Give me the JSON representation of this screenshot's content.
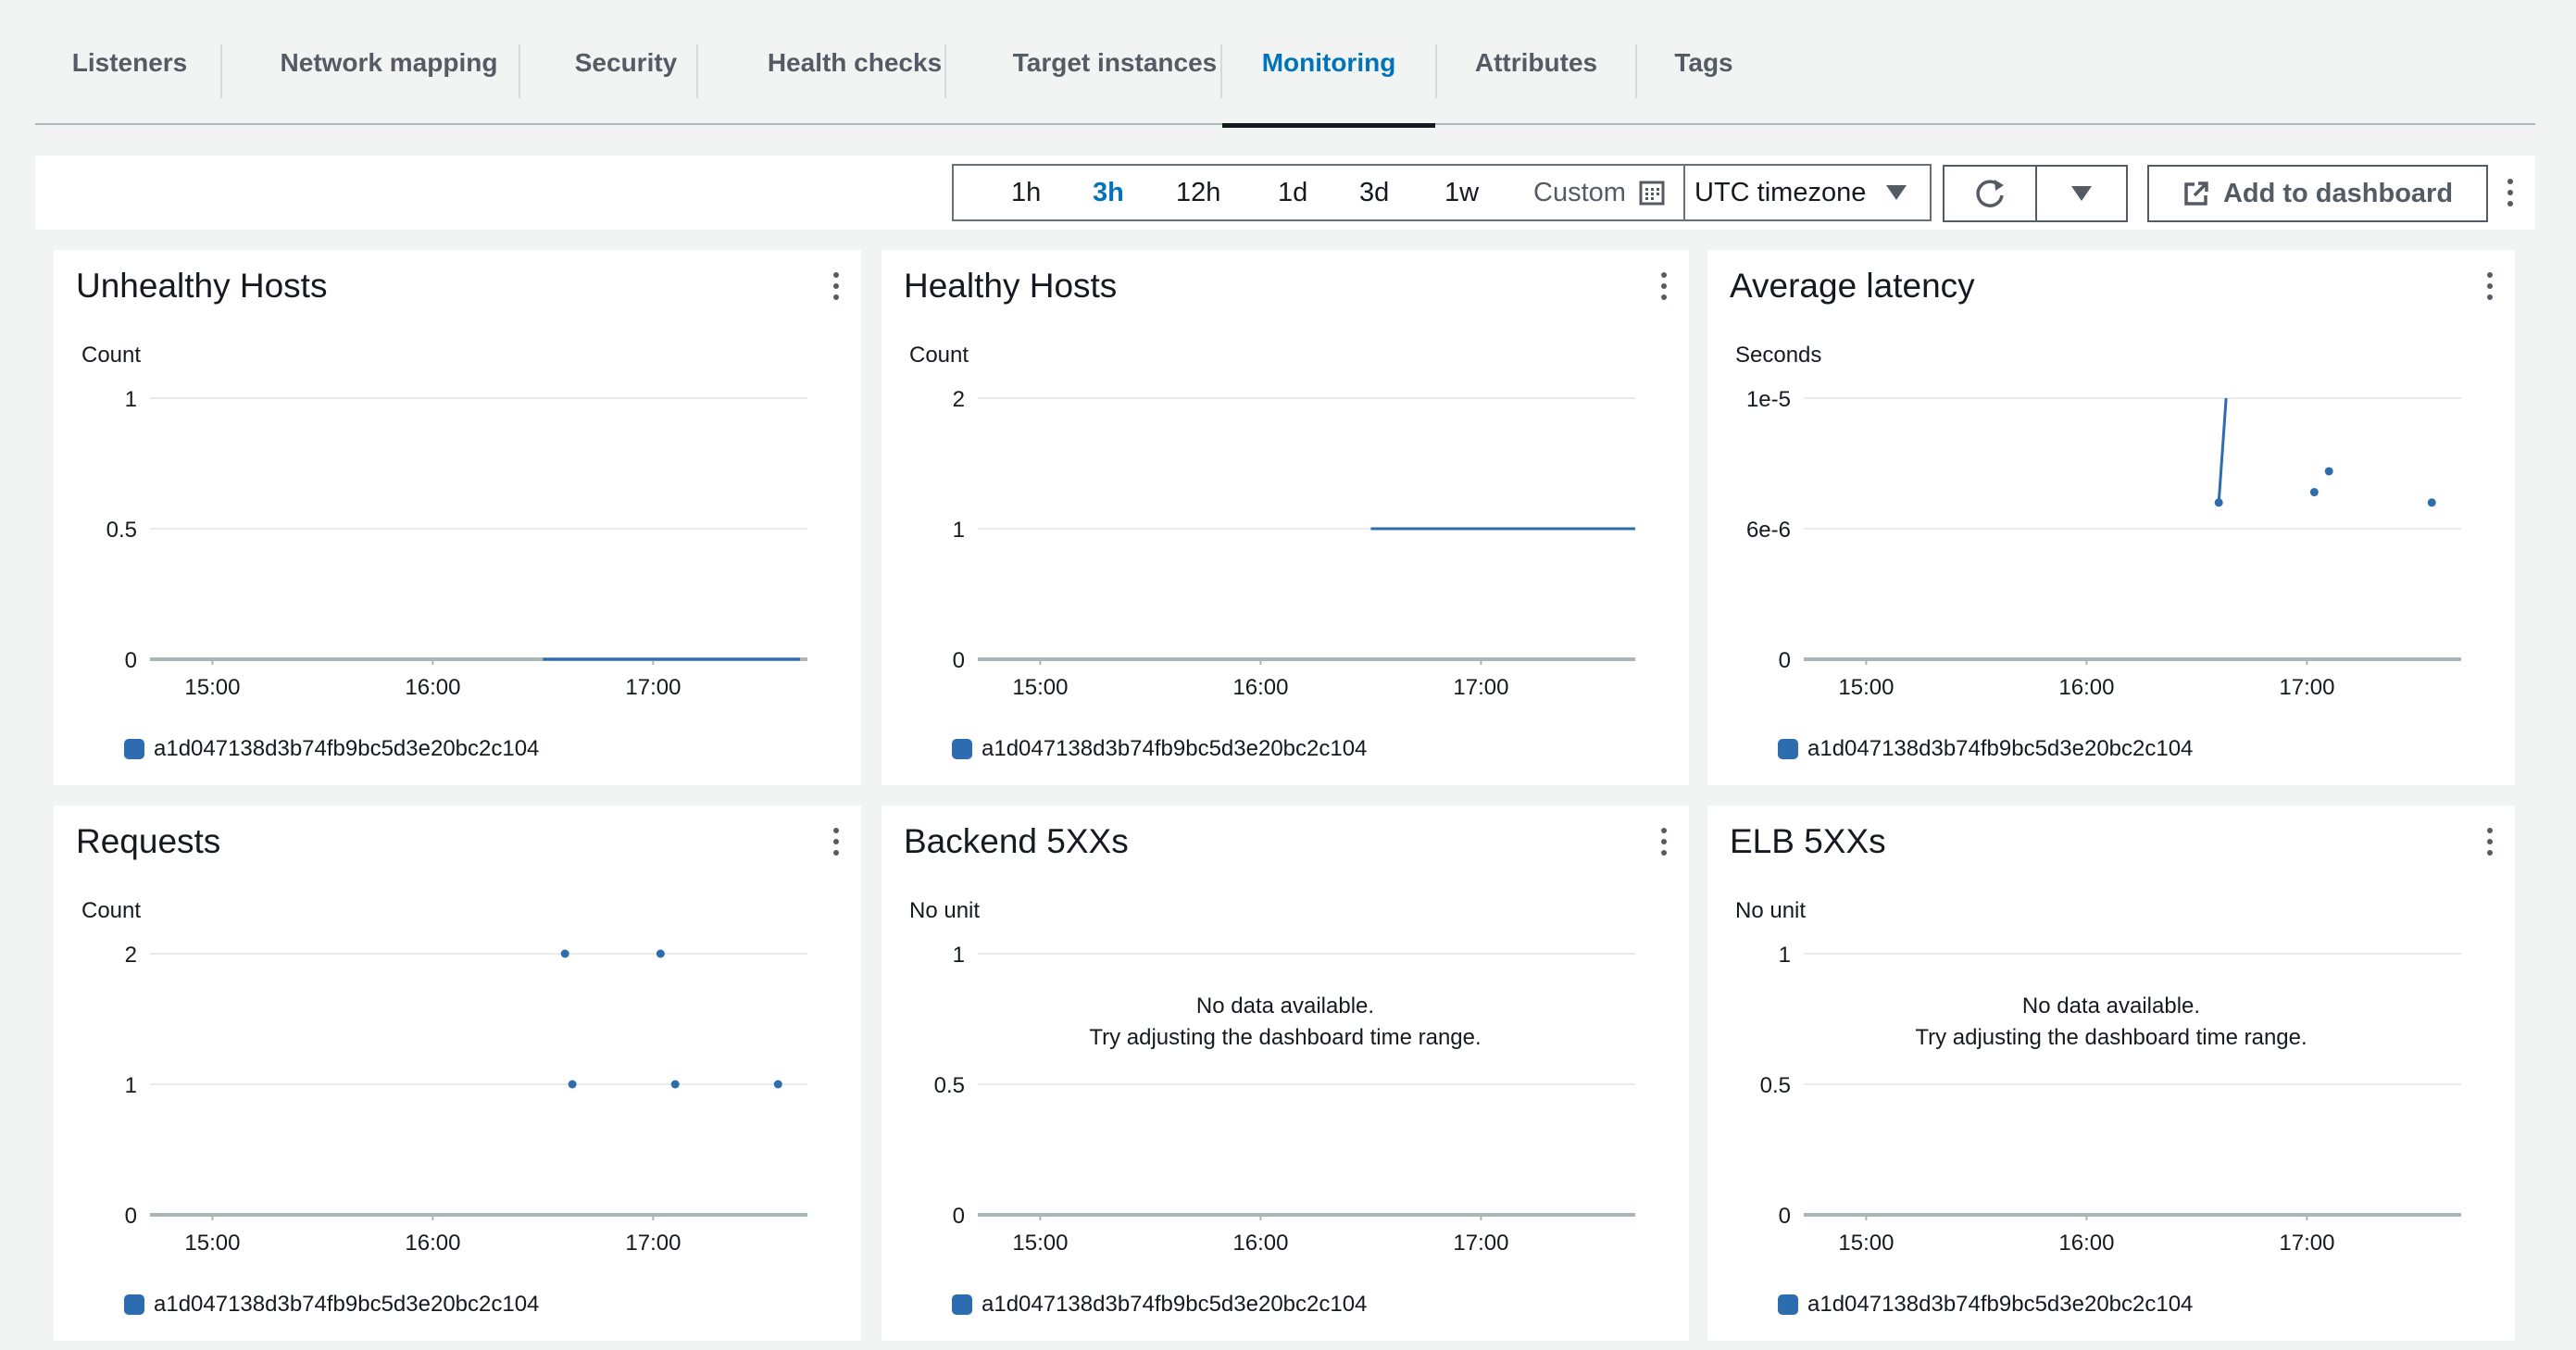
{
  "tabs": [
    {
      "label": "Listeners",
      "active": false
    },
    {
      "label": "Network mapping",
      "active": false
    },
    {
      "label": "Security",
      "active": false
    },
    {
      "label": "Health checks",
      "active": false
    },
    {
      "label": "Target instances",
      "active": false
    },
    {
      "label": "Monitoring",
      "active": true
    },
    {
      "label": "Attributes",
      "active": false
    },
    {
      "label": "Tags",
      "active": false
    }
  ],
  "toolbar": {
    "time_ranges": [
      "1h",
      "3h",
      "12h",
      "1d",
      "3d",
      "1w"
    ],
    "selected_range": "3h",
    "custom_label": "Custom",
    "timezone_label": "UTC timezone",
    "add_to_dashboard_label": "Add to dashboard",
    "icons": [
      "calendar-icon",
      "caret-down-icon",
      "refresh-icon",
      "external-link-icon",
      "more-vertical-icon"
    ]
  },
  "legend_label": "a1d047138d3b74fb9bc5d3e20bc2c104",
  "accent_color": "#0073bb",
  "series_color": "#2e6cb0",
  "widgets": [
    {
      "title": "Unhealthy Hosts",
      "unit": "Count"
    },
    {
      "title": "Healthy Hosts",
      "unit": "Count"
    },
    {
      "title": "Average latency",
      "unit": "Seconds"
    },
    {
      "title": "Requests",
      "unit": "Count"
    },
    {
      "title": "Backend 5XXs",
      "unit": "No unit",
      "no_data_line1": "No data available.",
      "no_data_line2": "Try adjusting the dashboard time range."
    },
    {
      "title": "ELB 5XXs",
      "unit": "No unit",
      "no_data_line1": "No data available.",
      "no_data_line2": "Try adjusting the dashboard time range."
    }
  ],
  "chart_data": [
    {
      "type": "line",
      "title": "Unhealthy Hosts",
      "ylabel": "Count",
      "x_ticks": [
        "15:00",
        "16:00",
        "17:00"
      ],
      "y_ticks": [
        "0",
        "0.5",
        "1"
      ],
      "ylim": [
        0,
        1
      ],
      "xlim": [
        "14:43",
        "17:42"
      ],
      "series": [
        {
          "name": "a1d047138d3b74fb9bc5d3e20bc2c104",
          "style": "line",
          "points": [
            [
              "16:30",
              0
            ],
            [
              "17:40",
              0
            ]
          ]
        }
      ]
    },
    {
      "type": "line",
      "title": "Healthy Hosts",
      "ylabel": "Count",
      "x_ticks": [
        "15:00",
        "16:00",
        "17:00"
      ],
      "y_ticks": [
        "0",
        "1",
        "2"
      ],
      "ylim": [
        0,
        2
      ],
      "xlim": [
        "14:43",
        "17:42"
      ],
      "series": [
        {
          "name": "a1d047138d3b74fb9bc5d3e20bc2c104",
          "style": "line",
          "points": [
            [
              "16:30",
              1
            ],
            [
              "17:42",
              1
            ]
          ]
        }
      ]
    },
    {
      "type": "line",
      "title": "Average latency",
      "ylabel": "Seconds",
      "x_ticks": [
        "15:00",
        "16:00",
        "17:00"
      ],
      "y_ticks": [
        "0",
        "6e-6",
        "1e-5"
      ],
      "ylim": [
        0,
        1e-05
      ],
      "xlim": [
        "14:43",
        "17:42"
      ],
      "series": [
        {
          "name": "a1d047138d3b74fb9bc5d3e20bc2c104",
          "style": "line",
          "points": [
            [
              "16:36",
              6e-06
            ],
            [
              "16:38",
              1e-05
            ]
          ]
        },
        {
          "name": "a1d047138d3b74fb9bc5d3e20bc2c104",
          "style": "points",
          "points": [
            [
              "16:36",
              6e-06
            ],
            [
              "17:02",
              6.4e-06
            ],
            [
              "17:06",
              7.2e-06
            ],
            [
              "17:34",
              6e-06
            ]
          ]
        }
      ]
    },
    {
      "type": "scatter",
      "title": "Requests",
      "ylabel": "Count",
      "x_ticks": [
        "15:00",
        "16:00",
        "17:00"
      ],
      "y_ticks": [
        "0",
        "1",
        "2"
      ],
      "ylim": [
        0,
        2
      ],
      "xlim": [
        "14:43",
        "17:42"
      ],
      "series": [
        {
          "name": "a1d047138d3b74fb9bc5d3e20bc2c104",
          "style": "points",
          "points": [
            [
              "16:36",
              2
            ],
            [
              "17:02",
              2
            ],
            [
              "16:38",
              1
            ],
            [
              "17:06",
              1
            ],
            [
              "17:34",
              1
            ]
          ]
        }
      ]
    },
    {
      "type": "line",
      "title": "Backend 5XXs",
      "ylabel": "No unit",
      "x_ticks": [
        "15:00",
        "16:00",
        "17:00"
      ],
      "y_ticks": [
        "0",
        "0.5",
        "1"
      ],
      "ylim": [
        0,
        1
      ],
      "xlim": [
        "14:43",
        "17:42"
      ],
      "series": []
    },
    {
      "type": "line",
      "title": "ELB 5XXs",
      "ylabel": "No unit",
      "x_ticks": [
        "15:00",
        "16:00",
        "17:00"
      ],
      "y_ticks": [
        "0",
        "0.5",
        "1"
      ],
      "ylim": [
        0,
        1
      ],
      "xlim": [
        "14:43",
        "17:42"
      ],
      "series": []
    }
  ]
}
